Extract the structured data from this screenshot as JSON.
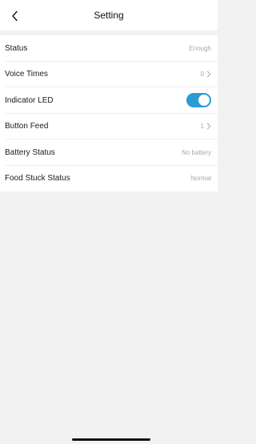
{
  "header": {
    "title": "Setting",
    "back_icon": "chevron-left-icon"
  },
  "settings": [
    {
      "label": "Status",
      "value": "Enough"
    },
    {
      "label": "Voice Times",
      "value": "0"
    },
    {
      "label": "Indicator LED",
      "toggle_on": true
    },
    {
      "label": "Button Feed",
      "value": "1"
    },
    {
      "label": "Battery Status",
      "value": "No battery"
    },
    {
      "label": "Food Stuck Status",
      "value": "Normal"
    }
  ],
  "colors": {
    "toggle_on": "#2a9bd6",
    "background": "#f2f2f2",
    "value_text": "#a8a8a8"
  }
}
